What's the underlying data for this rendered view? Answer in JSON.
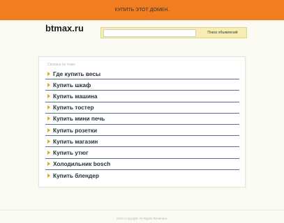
{
  "header": {
    "buy_domain": "КУПИТЬ ЭТОТ    ДОМЕН."
  },
  "site": {
    "logo": "btmax.ru"
  },
  "search": {
    "value": "",
    "placeholder": "",
    "button_label": "Поиск объявлений"
  },
  "related": {
    "label": "Связано по теме:",
    "links": [
      {
        "label": "Где купить весы"
      },
      {
        "label": "Купить шкаф"
      },
      {
        "label": "Купить машина"
      },
      {
        "label": "Купить тостер"
      },
      {
        "label": "Купить мини печь"
      },
      {
        "label": "Купить розетки"
      },
      {
        "label": "Купить магазин"
      },
      {
        "label": "Купить утюг"
      },
      {
        "label": "Холодильник bosch"
      },
      {
        "label": "Купить блендер"
      }
    ]
  },
  "footer": {
    "copyright": "2016 Copyright. All Rights Reserved."
  },
  "colors": {
    "topbar": "#f07e20",
    "background": "#fbfbf3",
    "search_box": "#f6edb2",
    "link_text": "#23303f",
    "arrow": "#e0a81a",
    "divider": "#5a6e8a"
  },
  "icons": {
    "list_marker": "arrow-icon"
  }
}
